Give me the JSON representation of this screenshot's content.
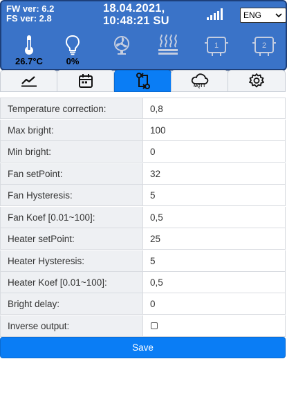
{
  "header": {
    "fw_version": "FW ver: 6.2",
    "fs_version": "FS ver: 2.8",
    "date": "18.04.2021,",
    "time": "10:48:21 SU",
    "language": "ENG",
    "sensors": {
      "temperature": "26.7°C",
      "light": "0%"
    },
    "icons": [
      "thermometer-icon",
      "lightbulb-icon",
      "fan-icon",
      "heater-icon",
      "relay-1-icon",
      "relay-2-icon",
      "signal-strength-icon"
    ]
  },
  "tabs": [
    {
      "name": "charts",
      "icon": "chart-icon"
    },
    {
      "name": "schedule",
      "icon": "calendar-icon"
    },
    {
      "name": "control",
      "icon": "control-routes-icon",
      "active": true
    },
    {
      "name": "mqtt",
      "icon": "cloud-icon",
      "label": "MQTT"
    },
    {
      "name": "settings",
      "icon": "gear-icon"
    }
  ],
  "settings": [
    {
      "label": "Temperature correction:",
      "value": "0,8"
    },
    {
      "label": "Max bright:",
      "value": "100"
    },
    {
      "label": "Min bright:",
      "value": "0"
    },
    {
      "label": "Fan setPoint:",
      "value": "32"
    },
    {
      "label": "Fan Hysteresis:",
      "value": "5"
    },
    {
      "label": "Fan Koef [0.01~100]:",
      "value": "0,5"
    },
    {
      "label": "Heater setPoint:",
      "value": "25"
    },
    {
      "label": "Heater Hysteresis:",
      "value": "5"
    },
    {
      "label": "Heater Koef [0.01~100]:",
      "value": "0,5"
    },
    {
      "label": "Bright delay:",
      "value": "0"
    },
    {
      "label": "Inverse output:",
      "checked": false
    }
  ],
  "save_label": "Save",
  "colors": {
    "header_bg": "#3a73c8",
    "accent": "#0a7df5",
    "label_bg": "#eef0f3"
  }
}
